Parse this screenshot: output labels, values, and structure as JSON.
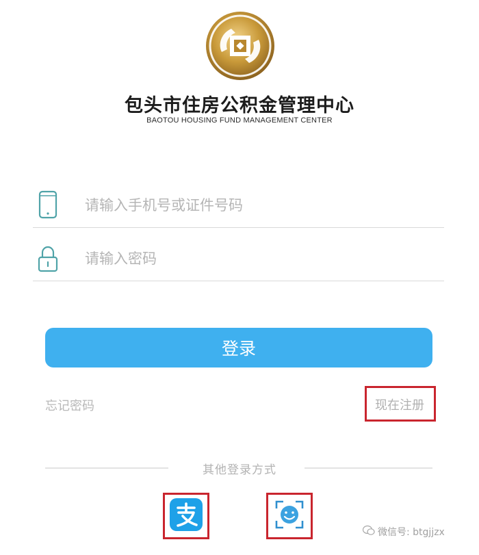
{
  "header": {
    "org_name": "包头市住房公积金管理中心",
    "org_name_en": "BAOTOU HOUSING FUND MANAGEMENT CENTER"
  },
  "form": {
    "phone_placeholder": "请输入手机号或证件号码",
    "phone_value": "",
    "password_placeholder": "请输入密码",
    "password_value": "",
    "login_label": "登录"
  },
  "links": {
    "forgot_label": "忘记密码",
    "register_label": "现在注册"
  },
  "other_login": {
    "label": "其他登录方式",
    "options": [
      {
        "name": "alipay",
        "icon": "alipay-icon"
      },
      {
        "name": "face-recognition",
        "icon": "face-scan-icon"
      }
    ]
  },
  "watermark": {
    "text": "微信号: btgjjzx",
    "icon": "wechat-icon"
  },
  "colors": {
    "primary": "#3fb0ef",
    "highlight_border": "#c9252e",
    "field_icon": "#4fa3a8",
    "logo_gold": "#c49a3c"
  }
}
